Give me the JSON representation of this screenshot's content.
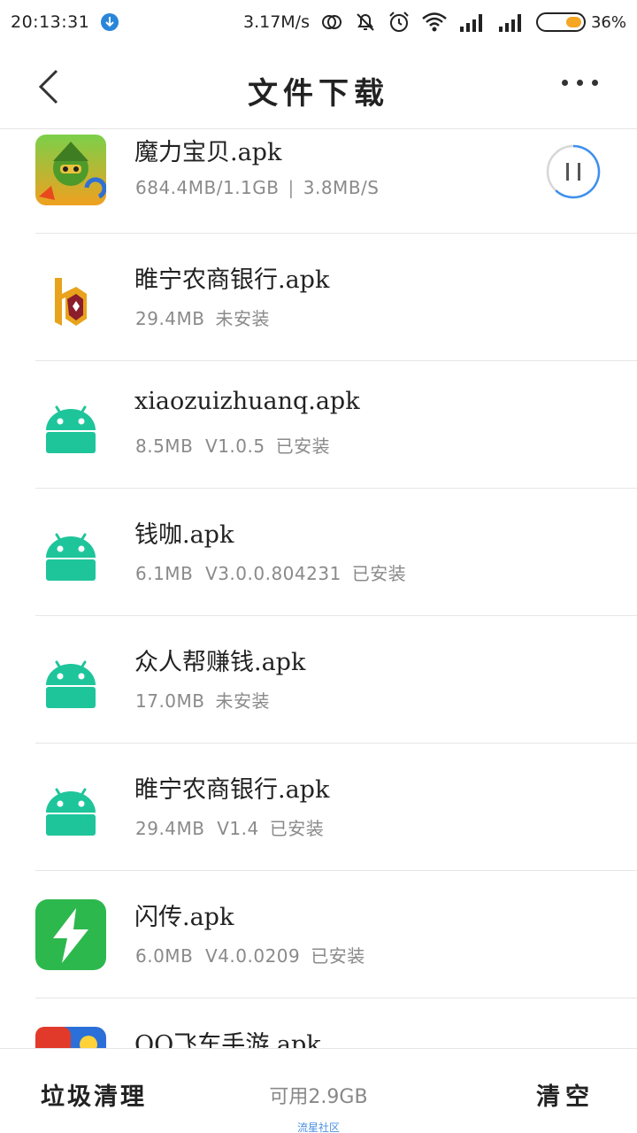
{
  "status_bar": {
    "time": "20:13:31",
    "speed": "3.17M/s",
    "battery_percent": "36%",
    "battery_level": 0.36,
    "icons": [
      "download-badge-icon",
      "sync-icon",
      "mute-icon",
      "alarm-icon",
      "wifi-icon",
      "signal-icon",
      "signal-icon",
      "battery-icon"
    ]
  },
  "header": {
    "title": "文件下载"
  },
  "files": [
    {
      "name": "魔力宝贝.apk",
      "size": "684.4MB/1.1GB",
      "speed": "3.8MB/S",
      "icon": "game-app-icon",
      "progress": 0.62
    },
    {
      "name": "睢宁农商银行.apk",
      "size": "29.4MB",
      "status": "未安装",
      "icon": "bank-app-icon"
    },
    {
      "name": "xiaozuizhuanq.apk",
      "size": "8.5MB",
      "version": "V1.0.5",
      "status": "已安装",
      "icon": "android-icon"
    },
    {
      "name": "钱咖.apk",
      "size": "6.1MB",
      "version": "V3.0.0.804231",
      "status": "已安装",
      "icon": "android-icon"
    },
    {
      "name": "众人帮赚钱.apk",
      "size": "17.0MB",
      "status": "未安装",
      "icon": "android-icon"
    },
    {
      "name": "睢宁农商银行.apk",
      "size": "29.4MB",
      "version": "V1.4",
      "status": "已安装",
      "icon": "android-icon"
    },
    {
      "name": "闪传.apk",
      "size": "6.0MB",
      "version": "V4.0.0209",
      "status": "已安装",
      "icon": "lightning-app-icon"
    },
    {
      "name": "QQ飞车手游.apk",
      "size": "",
      "icon": "racing-game-icon"
    }
  ],
  "bottom": {
    "clean_label": "垃圾清理",
    "available_label": "可用2.9GB",
    "clear_label": "清空",
    "watermark": "流星社区"
  },
  "colors": {
    "android_green": "#1ec59a",
    "flash_green": "#2db84d",
    "progress_blue": "#3d8ff0",
    "battery_orange": "#f5a623"
  }
}
